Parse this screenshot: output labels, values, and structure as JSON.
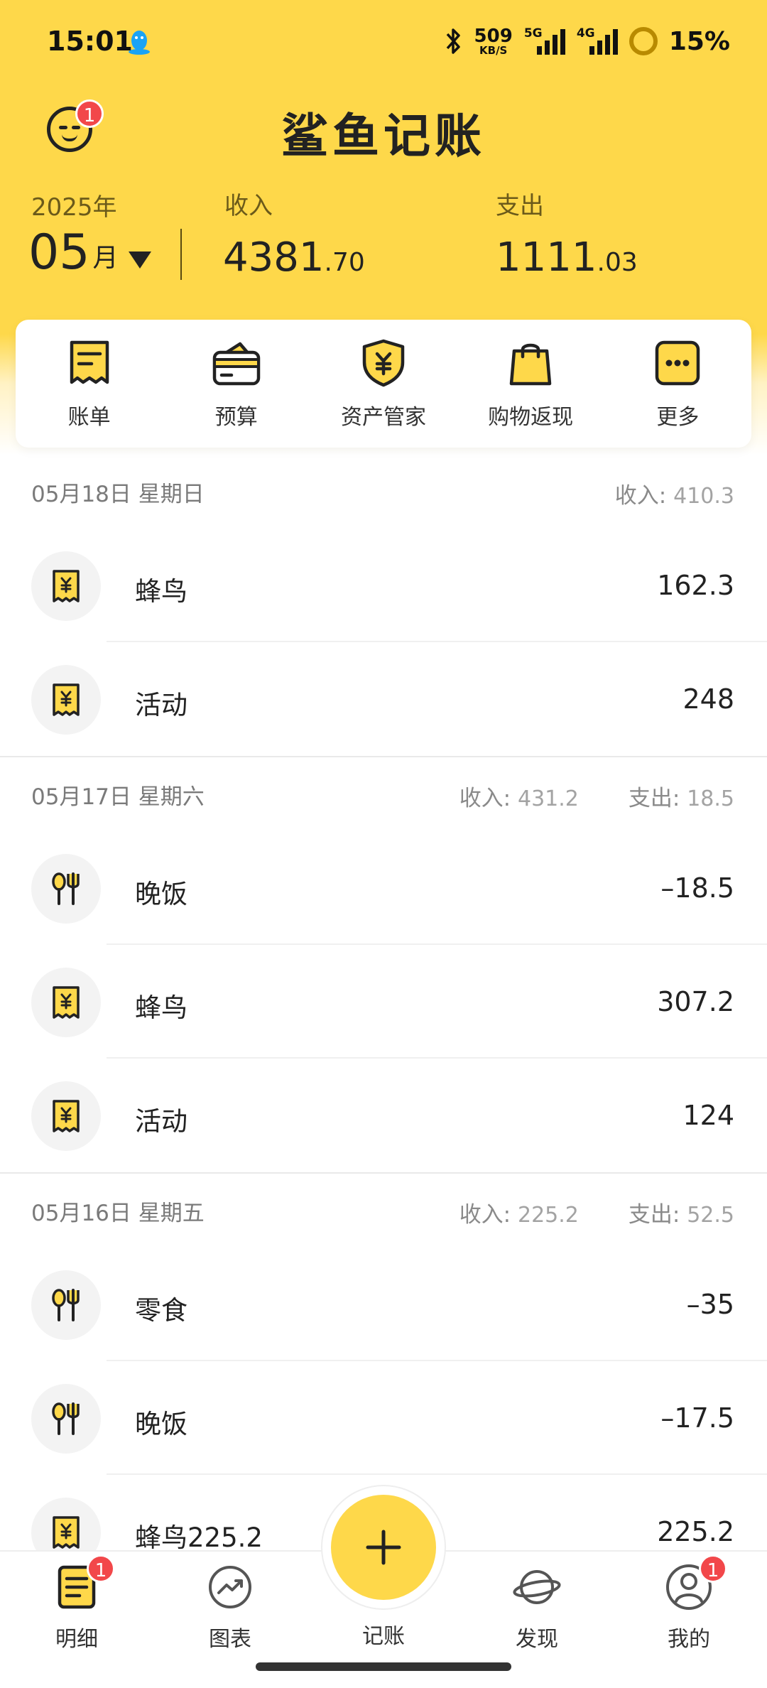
{
  "status": {
    "time": "15:01",
    "net_speed": "509",
    "net_unit": "KB/S",
    "sig1": "5G",
    "sig2": "4G",
    "battery": "15%"
  },
  "header": {
    "title": "鲨鱼记账",
    "avatar_badge": "1",
    "year": "2025年",
    "month": "05",
    "month_unit": "月",
    "income_label": "收入",
    "income_int": "4381",
    "income_dec": ".70",
    "expense_label": "支出",
    "expense_int": "1111",
    "expense_dec": ".03"
  },
  "quick_menu": [
    {
      "label": "账单",
      "icon": "bill-icon"
    },
    {
      "label": "预算",
      "icon": "budget-wallet-icon"
    },
    {
      "label": "资产管家",
      "icon": "asset-shield-icon"
    },
    {
      "label": "购物返现",
      "icon": "shopping-bag-icon"
    },
    {
      "label": "更多",
      "icon": "more-dots-icon"
    }
  ],
  "groups": [
    {
      "date": "05月18日 星期日",
      "income_label": "收入:",
      "income": "410.3",
      "items": [
        {
          "name": "蜂鸟",
          "amount": "162.3",
          "icon": "receipt-yen-icon"
        },
        {
          "name": "活动",
          "amount": "248",
          "icon": "receipt-yen-icon"
        }
      ]
    },
    {
      "date": "05月17日 星期六",
      "income_label": "收入:",
      "income": "431.2",
      "expense_label": "支出:",
      "expense": "18.5",
      "items": [
        {
          "name": "晚饭",
          "amount": "–18.5",
          "icon": "dining-utensils-icon"
        },
        {
          "name": "蜂鸟",
          "amount": "307.2",
          "icon": "receipt-yen-icon"
        },
        {
          "name": "活动",
          "amount": "124",
          "icon": "receipt-yen-icon"
        }
      ]
    },
    {
      "date": "05月16日 星期五",
      "income_label": "收入:",
      "income": "225.2",
      "expense_label": "支出:",
      "expense": "52.5",
      "items": [
        {
          "name": "零食",
          "amount": "–35",
          "icon": "dining-utensils-icon"
        },
        {
          "name": "晚饭",
          "amount": "–17.5",
          "icon": "dining-utensils-icon"
        },
        {
          "name": "蜂鸟225.2",
          "amount": "225.2",
          "icon": "receipt-yen-icon"
        }
      ]
    }
  ],
  "bottom_nav": {
    "details": {
      "label": "明细",
      "badge": "1",
      "icon": "details-list-icon"
    },
    "charts": {
      "label": "图表",
      "icon": "chart-trend-icon"
    },
    "record": {
      "label": "记账",
      "icon": "plus-icon"
    },
    "discover": {
      "label": "发现",
      "icon": "planet-icon"
    },
    "mine": {
      "label": "我的",
      "badge": "1",
      "icon": "user-profile-icon"
    }
  },
  "colors": {
    "brand_yellow": "#FED84A",
    "badge_red": "#F2474A",
    "text_dark": "#222222"
  }
}
